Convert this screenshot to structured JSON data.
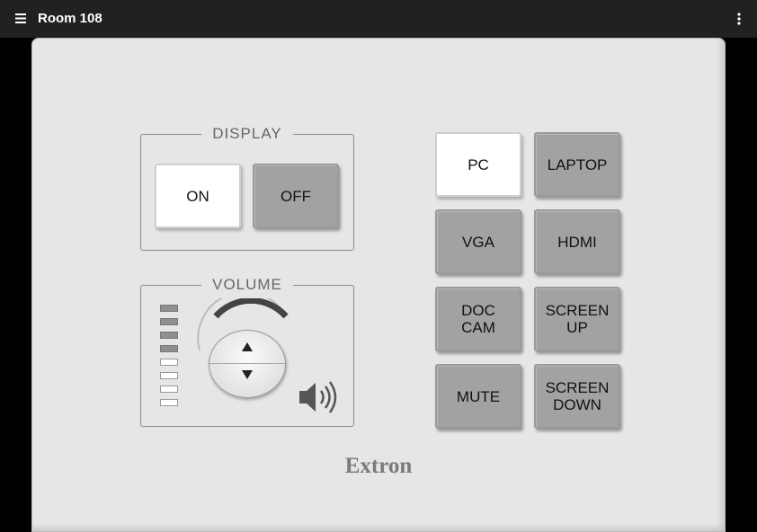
{
  "app_bar": {
    "title": "Room 108",
    "menu_icon": "hamburger-menu-icon",
    "more_icon": "more-vert-icon"
  },
  "display": {
    "label": "DISPLAY",
    "on_label": "ON",
    "off_label": "OFF"
  },
  "volume": {
    "label": "VOLUME",
    "level_bars_total": 8,
    "level_bars_lit": 4,
    "up_icon": "triangle-up-icon",
    "down_icon": "triangle-down-icon",
    "speaker_icon": "speaker-icon"
  },
  "sources": {
    "pc": "PC",
    "laptop": "LAPTOP",
    "vga": "VGA",
    "hdmi": "HDMI",
    "doc_cam": "DOC\nCAM",
    "screen_up": "SCREEN\nUP",
    "mute": "MUTE",
    "screen_down": "SCREEN\nDOWN"
  },
  "brand": "Extron",
  "colors": {
    "app_bar": "#212121",
    "panel": "#e6e6e6",
    "button_gray": "#a2a2a2",
    "button_selected": "#ffffff"
  }
}
